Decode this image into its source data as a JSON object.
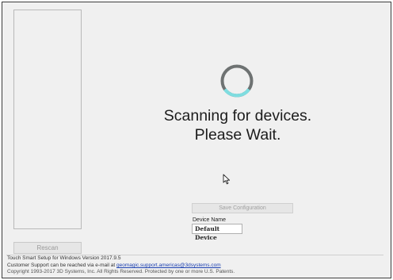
{
  "app": {
    "rescan_label": "Rescan",
    "status_line1": "Scanning for devices.",
    "status_line2": "Please Wait.",
    "save_configuration_label": "Save Configuration",
    "device_name_label": "Device Name",
    "device_name_value": "Default Device"
  },
  "footer": {
    "version_text": "Touch Smart Setup for Windows Version 2017.9.5",
    "support_prefix": "Customer Support can be reached via e-mail at ",
    "support_email": "geomagic.support.americas@3dsystems.com",
    "copyright": "Copyright 1993-2017 3D Systems, Inc. All Rights Reserved. Protected by one or more U.S. Patents."
  },
  "icons": {
    "spinner": "loading-ring-icon",
    "cursor": "mouse-pointer-icon"
  },
  "colors": {
    "spinner_track": "#6e7272",
    "spinner_accent": "#7fdde0",
    "link": "#1a3fb0"
  }
}
